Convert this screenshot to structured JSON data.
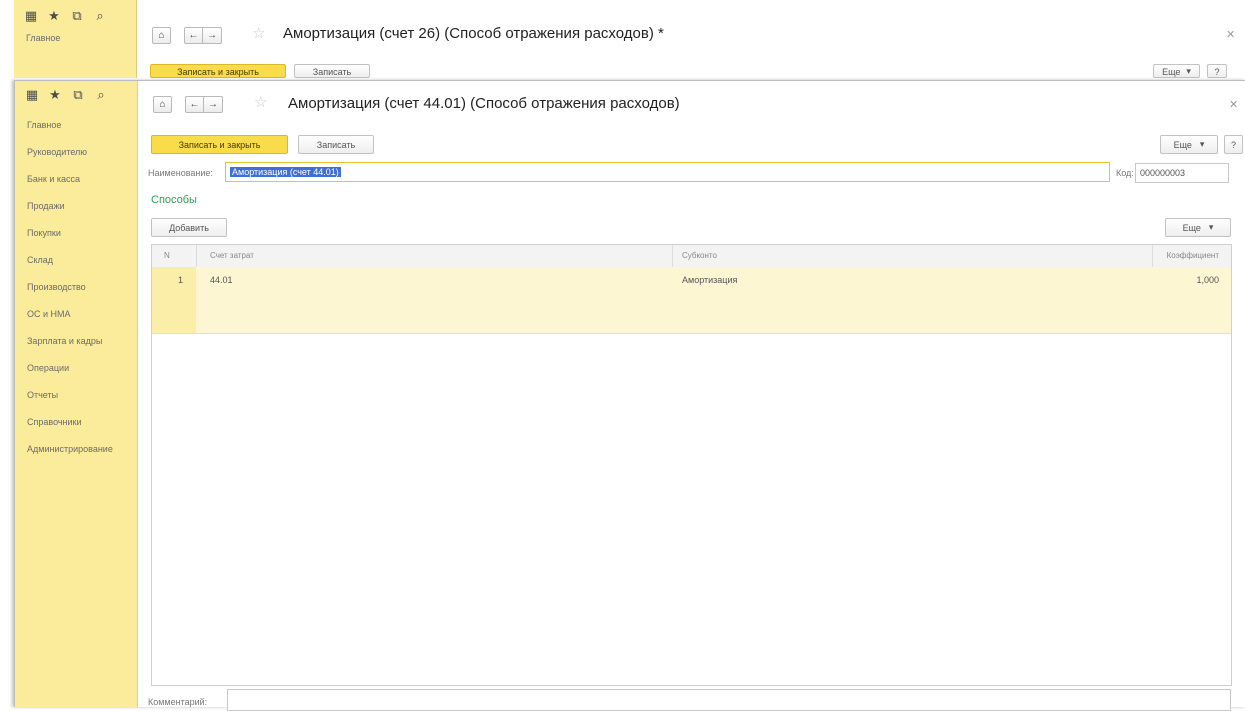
{
  "bg_window": {
    "sidebar": {
      "item": "Главное"
    },
    "title": "Амортизация (счет 26) (Способ отражения расходов) *",
    "save_close": "Записать и закрыть",
    "save": "Записать",
    "more": "Еще",
    "help": "?"
  },
  "fg_window": {
    "sidebar_items": [
      "Главное",
      "Руководителю",
      "Банк и касса",
      "Продажи",
      "Покупки",
      "Склад",
      "Производство",
      "ОС и НМА",
      "Зарплата и кадры",
      "Операции",
      "Отчеты",
      "Справочники",
      "Администрирование"
    ],
    "title": "Амортизация (счет 44.01) (Способ отражения расходов)",
    "save_close": "Записать и закрыть",
    "save": "Записать",
    "more": "Еще",
    "help": "?",
    "name_label": "Наименование:",
    "name_value": "Амортизация (счет 44.01)",
    "code_label": "Код:",
    "code_value": "000000003",
    "section": "Способы",
    "add": "Добавить",
    "table_more": "Еще",
    "columns": {
      "n": "N",
      "account": "Счет затрат",
      "subconto": "Субконто",
      "coef": "Коэффициент"
    },
    "rows": [
      {
        "n": "1",
        "account": "44.01",
        "subconto": "Амортизация",
        "coef": "1,000"
      }
    ],
    "comment_label": "Комментарий:"
  },
  "icons": [
    "grid-icon",
    "star-icon",
    "history-icon",
    "search-icon",
    "home-icon",
    "back-arrow-icon",
    "forward-arrow-icon",
    "favorite-star-icon",
    "close-icon",
    "dropdown-arrow-icon"
  ],
  "colors": {
    "sidebar": "#fbec9c",
    "primary_button": "#f9dc4a",
    "selection": "#3f6fd8",
    "section_title": "#2f9b57",
    "row_highlight": "#fdf6d3"
  }
}
